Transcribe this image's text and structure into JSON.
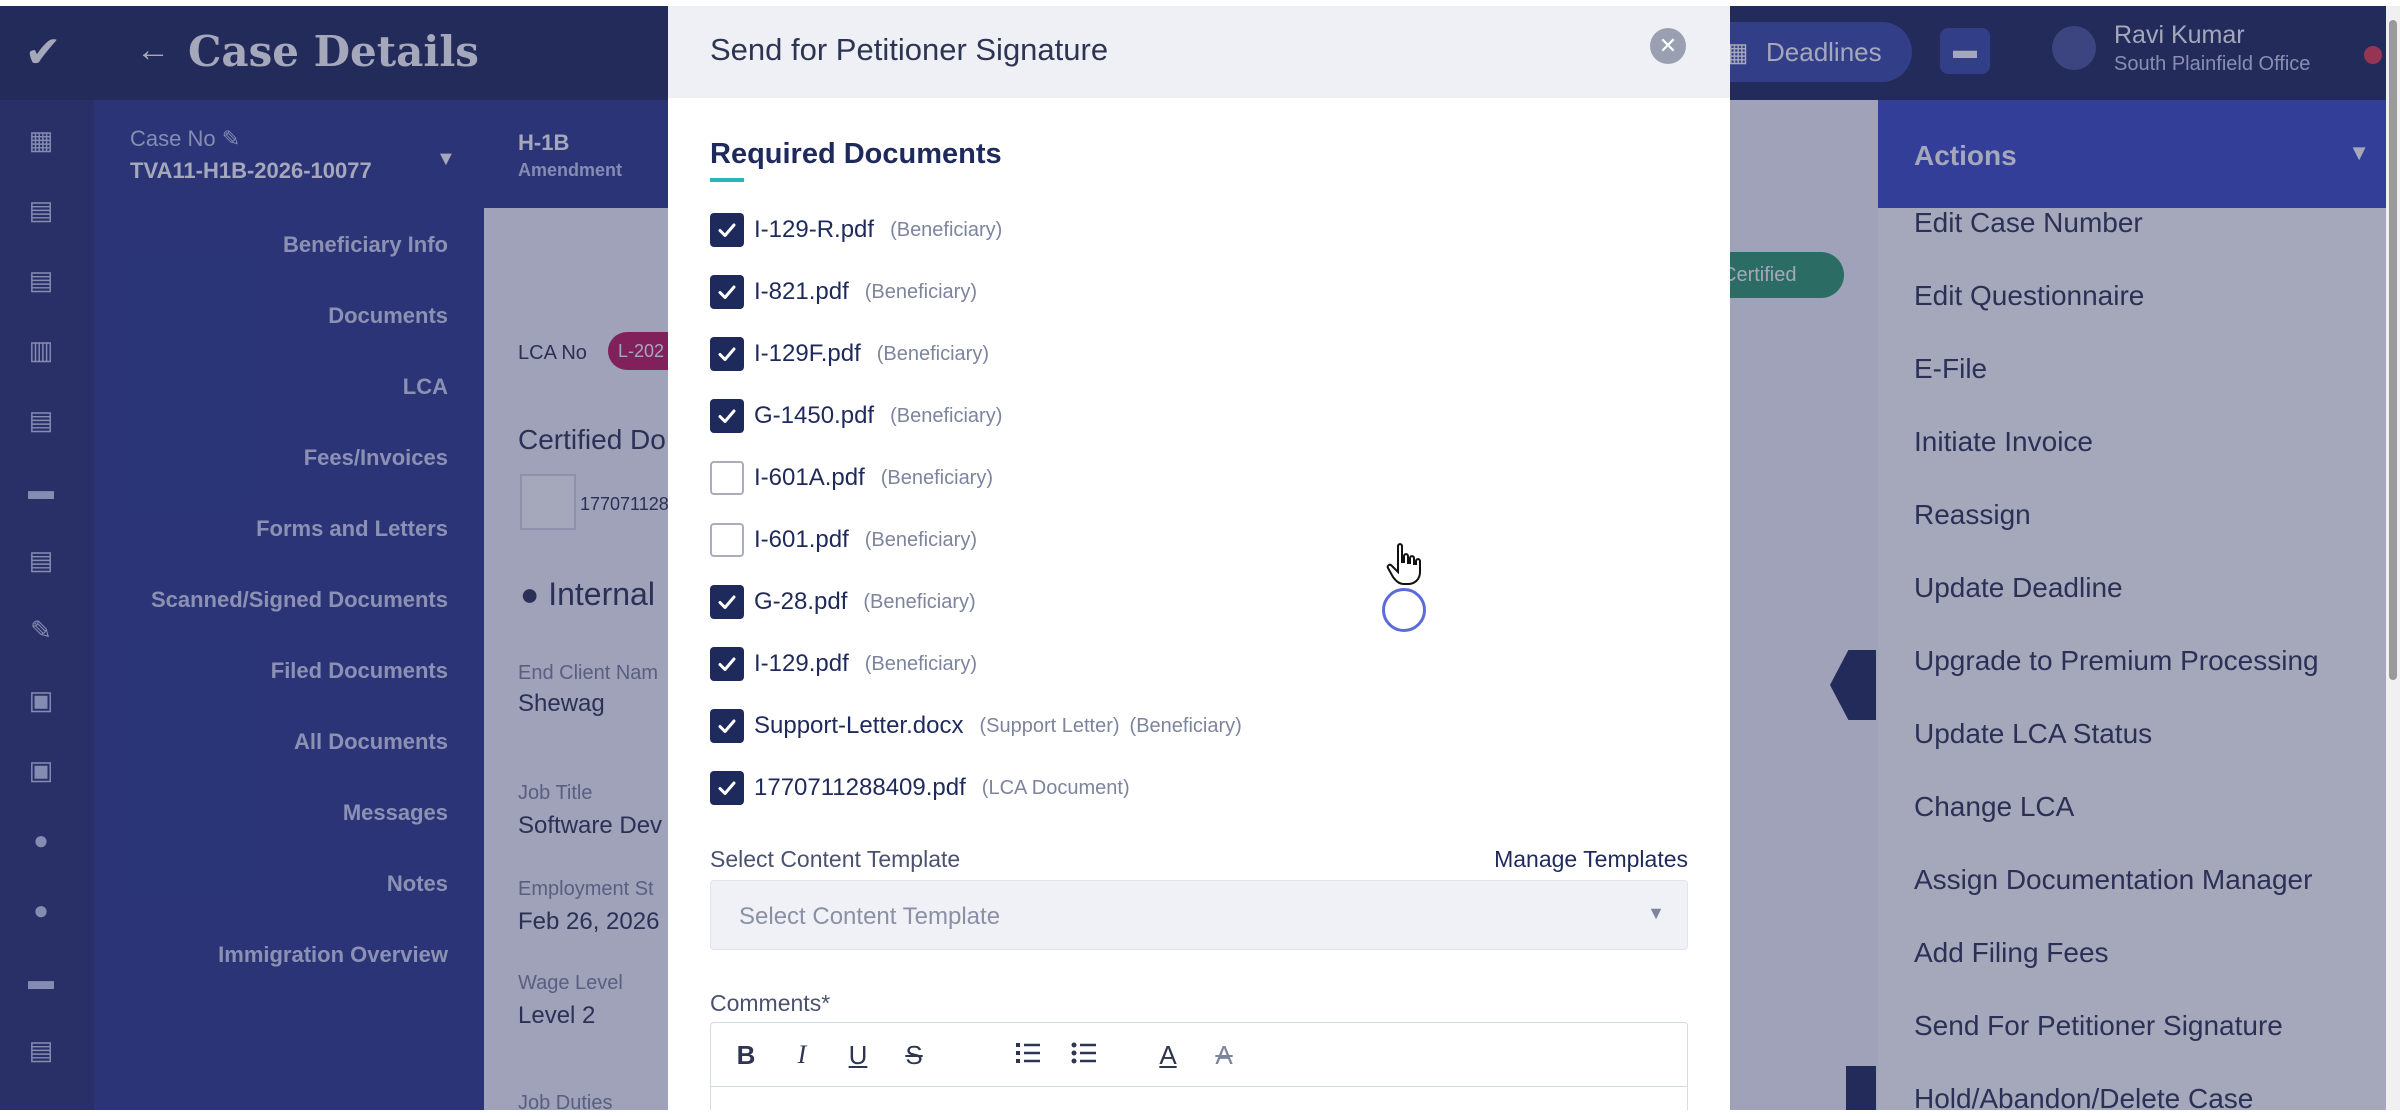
{
  "header": {
    "back_icon": "arrow-left-icon",
    "title": "Case Details",
    "deadlines_label": "Deadlines",
    "user_name": "Ravi Kumar",
    "user_office": "South Plainfield Office"
  },
  "case": {
    "case_no_label": "Case No",
    "case_no_value": "TVA11-H1B-2026-10077",
    "visa_type": "H-1B",
    "visa_sub": "Amendment"
  },
  "case_nav": [
    "Beneficiary Info",
    "Documents",
    "LCA",
    "Fees/Invoices",
    "Forms and Letters",
    "Scanned/Signed Documents",
    "Filed Documents",
    "All Documents",
    "Messages",
    "Notes",
    "Immigration Overview"
  ],
  "main": {
    "lca_no_label": "LCA No",
    "lca_no_badge": "L-202",
    "certified_docs": "Certified Do",
    "doc_thumb_name": "177071128",
    "internal_title": "Internal",
    "end_client_label": "End Client Nam",
    "end_client_value": "Shewag",
    "job_title_label": "Job Title",
    "job_title_value": "Software Dev",
    "employment_label": "Employment St",
    "employment_value": "Feb 26, 2026",
    "wage_level_label": "Wage Level",
    "wage_level_value": "Level 2",
    "job_duties_label": "Job Duties",
    "status_pill": "Certified"
  },
  "actions": {
    "title": "Actions",
    "items": [
      "Edit Case Number",
      "Edit Questionnaire",
      "E-File",
      "Initiate Invoice",
      "Reassign",
      "Update Deadline",
      "Upgrade to Premium Processing",
      "Update LCA Status",
      "Change LCA",
      "Assign Documentation Manager",
      "Add Filing Fees",
      "Send For Petitioner Signature",
      "Hold/Abandon/Delete Case"
    ]
  },
  "modal": {
    "title": "Send for Petitioner Signature",
    "required_title": "Required Documents",
    "documents": [
      {
        "name": "I-129-R.pdf",
        "tags": [
          "(Beneficiary)"
        ],
        "checked": true
      },
      {
        "name": "I-821.pdf",
        "tags": [
          "(Beneficiary)"
        ],
        "checked": true
      },
      {
        "name": "I-129F.pdf",
        "tags": [
          "(Beneficiary)"
        ],
        "checked": true
      },
      {
        "name": "G-1450.pdf",
        "tags": [
          "(Beneficiary)"
        ],
        "checked": true
      },
      {
        "name": "I-601A.pdf",
        "tags": [
          "(Beneficiary)"
        ],
        "checked": false
      },
      {
        "name": "I-601.pdf",
        "tags": [
          "(Beneficiary)"
        ],
        "checked": false
      },
      {
        "name": "G-28.pdf",
        "tags": [
          "(Beneficiary)"
        ],
        "checked": true
      },
      {
        "name": "I-129.pdf",
        "tags": [
          "(Beneficiary)"
        ],
        "checked": true
      },
      {
        "name": "Support-Letter.docx",
        "tags": [
          "(Support Letter)",
          "(Beneficiary)"
        ],
        "checked": true
      },
      {
        "name": "1770711288409.pdf",
        "tags": [
          "(LCA Document)"
        ],
        "checked": true
      }
    ],
    "template_label": "Select Content Template",
    "manage_templates": "Manage Templates",
    "template_placeholder": "Select Content Template",
    "comments_label": "Comments*",
    "toolbar": {
      "bold": "B",
      "italic": "I",
      "underline": "U",
      "strike": "S",
      "ordered_list_icon": "ordered-list-icon",
      "bullet_list_icon": "bullet-list-icon",
      "font_color_label": "A",
      "clear_format_label": "A"
    }
  },
  "colors": {
    "navy": "#1f2a5c",
    "accent_teal": "#29b6b9",
    "actions_blue": "#3b4bc4",
    "badge_pink": "#c2185b",
    "certified_green": "#2e9a6c"
  }
}
